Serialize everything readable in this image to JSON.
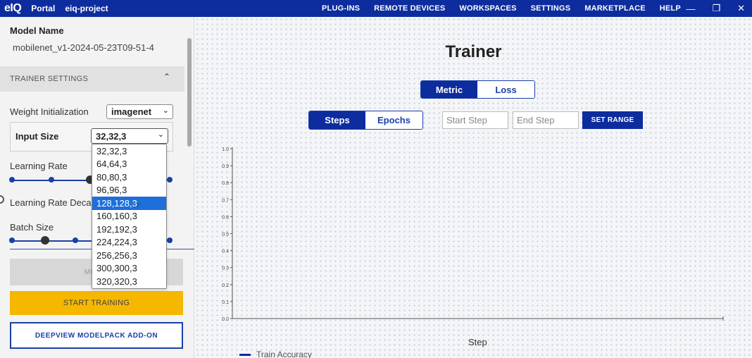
{
  "topbar": {
    "logo": "eIQ",
    "portal": "Portal",
    "project": "eiq-project",
    "nav": [
      "PLUG-INS",
      "REMOTE DEVICES",
      "WORKSPACES",
      "SETTINGS",
      "MARKETPLACE",
      "HELP"
    ],
    "bg_color": "#0d2c9e"
  },
  "sidebar": {
    "model_name_label": "Model Name",
    "model_name_value": "mobilenet_v1-2024-05-23T09-51-4",
    "trainer_settings_label": "TRAINER SETTINGS",
    "weight_init_label": "Weight Initialization",
    "weight_init_value": "imagenet",
    "input_size_label": "Input Size",
    "input_size_value": "32,32,3",
    "learning_rate_label": "Learning Rate",
    "lr_decay_label": "Learning Rate Deca",
    "batch_size_label": "Batch Size",
    "disabled_button_label": "MOD",
    "start_training_label": "START TRAINING",
    "deepview_label": "DEEPVIEW MODELPACK ADD-ON",
    "accent_color": "#f5b700"
  },
  "dropdown": {
    "options": [
      "32,32,3",
      "64,64,3",
      "80,80,3",
      "96,96,3",
      "128,128,3",
      "160,160,3",
      "192,192,3",
      "224,224,3",
      "256,256,3",
      "300,300,3",
      "320,320,3"
    ],
    "highlighted_index": 4
  },
  "main": {
    "title": "Trainer",
    "metric_label": "Metric",
    "loss_label": "Loss",
    "steps_label": "Steps",
    "epochs_label": "Epochs",
    "start_step_placeholder": "Start Step",
    "end_step_placeholder": "End Step",
    "set_range_label": "SET RANGE",
    "x_axis_label": "Step",
    "legend_label": "Train Accuracy"
  },
  "chart_data": {
    "type": "line",
    "title": "",
    "xlabel": "Step",
    "ylabel": "",
    "ylim": [
      0,
      1
    ],
    "y_ticks": [
      "0.0",
      "0.1",
      "0.2",
      "0.3",
      "0.4",
      "0.5",
      "0.6",
      "0.7",
      "0.8",
      "0.9",
      "1.0"
    ],
    "series": [
      {
        "name": "Train Accuracy",
        "values": []
      }
    ],
    "legend_position": "bottom-left"
  }
}
